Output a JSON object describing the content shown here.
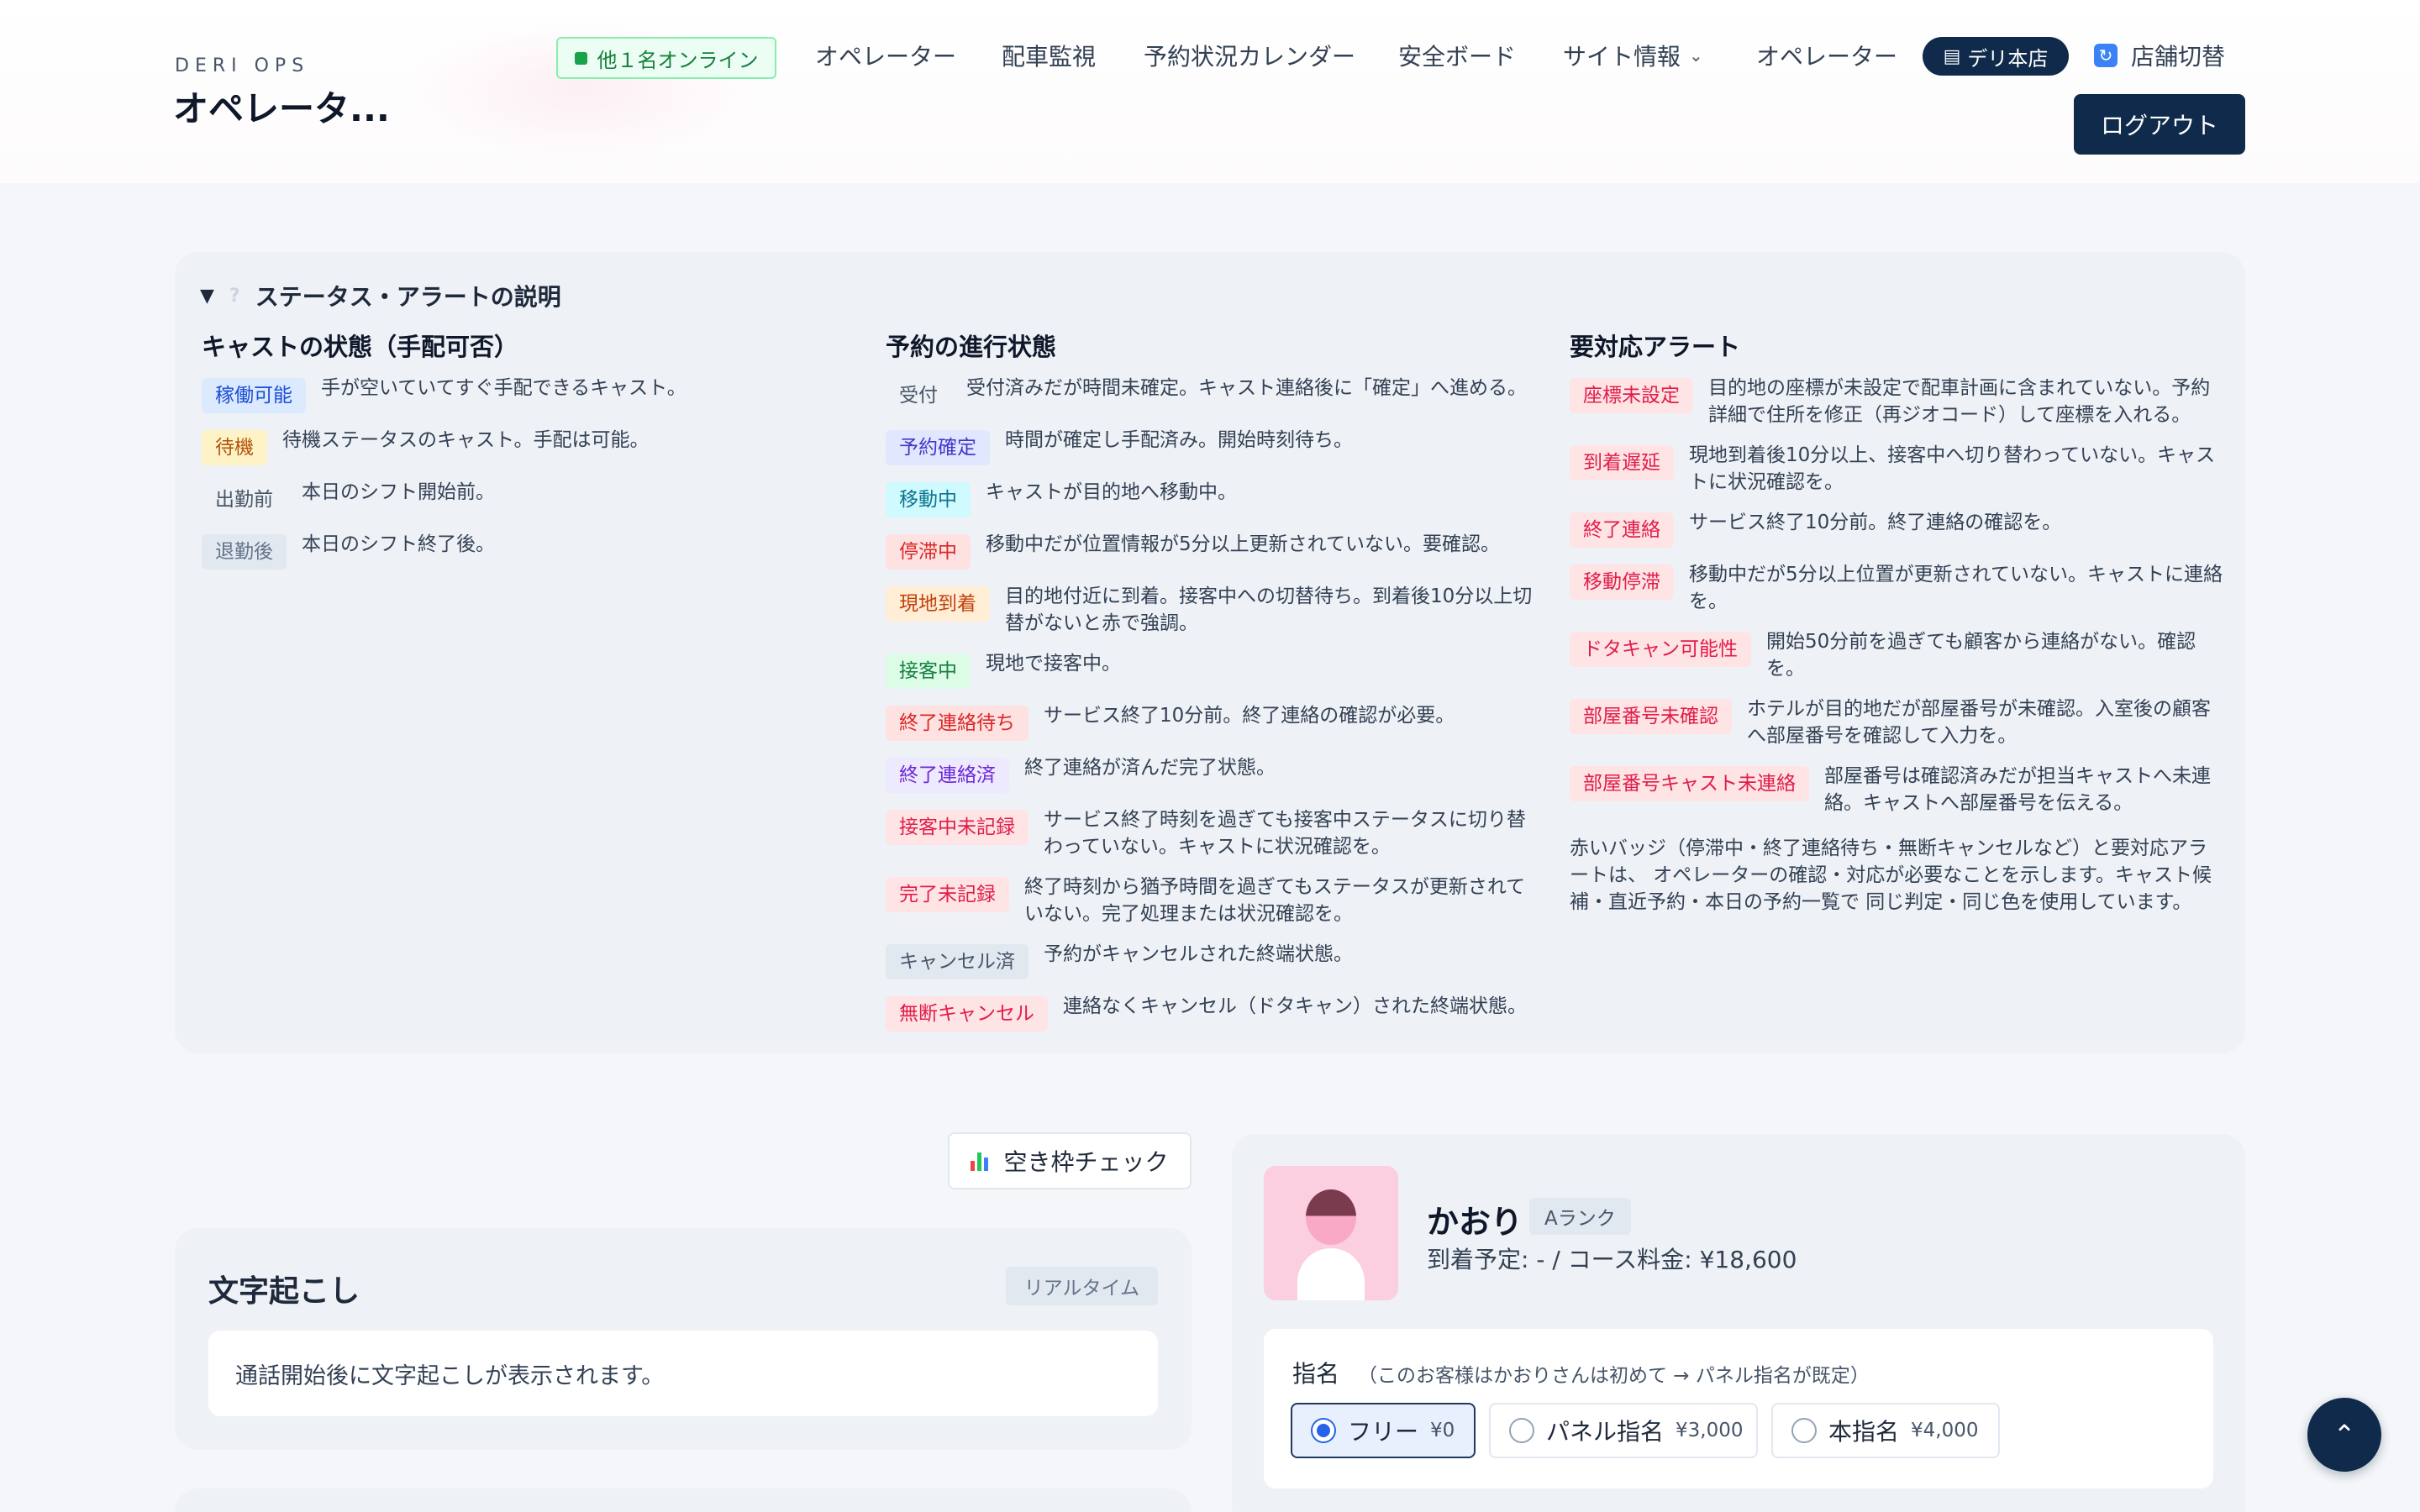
{
  "header": {
    "brand_sub": "DERI OPS",
    "brand_title": "オペレータ...",
    "online_badge": "他１名オンライン",
    "nav": [
      {
        "label": "オペレーター"
      },
      {
        "label": "配車監視"
      },
      {
        "label": "予約状況カレンダー"
      },
      {
        "label": "安全ボード"
      },
      {
        "label": "サイト情報"
      },
      {
        "label": "オペレーター"
      }
    ],
    "store_pill": "デリ本店",
    "switch_store": "店舗切替",
    "logout": "ログアウト"
  },
  "legend": {
    "toggle_label": "ステータス・アラートの説明",
    "cast": {
      "heading": "キャストの状態（手配可否）",
      "items": [
        {
          "badge": "稼働可能",
          "desc": "手が空いていてすぐ手配できるキャスト。"
        },
        {
          "badge": "待機",
          "desc": "待機ステータスのキャスト。手配は可能。"
        },
        {
          "badge": "出勤前",
          "desc": "本日のシフト開始前。"
        },
        {
          "badge": "退勤後",
          "desc": "本日のシフト終了後。"
        }
      ]
    },
    "booking": {
      "heading": "予約の進行状態",
      "items": [
        {
          "badge": "受付",
          "desc": "受付済みだが時間未確定。キャスト連絡後に「確定」へ進める。"
        },
        {
          "badge": "予約確定",
          "desc": "時間が確定し手配済み。開始時刻待ち。"
        },
        {
          "badge": "移動中",
          "desc": "キャストが目的地へ移動中。"
        },
        {
          "badge": "停滞中",
          "desc": "移動中だが位置情報が5分以上更新されていない。要確認。"
        },
        {
          "badge": "現地到着",
          "desc": "目的地付近に到着。接客中への切替待ち。到着後10分以上切替がないと赤で強調。"
        },
        {
          "badge": "接客中",
          "desc": "現地で接客中。"
        },
        {
          "badge": "終了連絡待ち",
          "desc": "サービス終了10分前。終了連絡の確認が必要。"
        },
        {
          "badge": "終了連絡済",
          "desc": "終了連絡が済んだ完了状態。"
        },
        {
          "badge": "接客中未記録",
          "desc": "サービス終了時刻を過ぎても接客中ステータスに切り替わっていない。キャストに状況確認を。"
        },
        {
          "badge": "完了未記録",
          "desc": "終了時刻から猶予時間を過ぎてもステータスが更新されていない。完了処理または状況確認を。"
        },
        {
          "badge": "キャンセル済",
          "desc": "予約がキャンセルされた終端状態。"
        },
        {
          "badge": "無断キャンセル",
          "desc": "連絡なくキャンセル（ドタキャン）された終端状態。"
        }
      ]
    },
    "alerts": {
      "heading": "要対応アラート",
      "items": [
        {
          "badge": "座標未設定",
          "desc": "目的地の座標が未設定で配車計画に含まれていない。予約詳細で住所を修正（再ジオコード）して座標を入れる。"
        },
        {
          "badge": "到着遅延",
          "desc": "現地到着後10分以上、接客中へ切り替わっていない。キャストに状況確認を。"
        },
        {
          "badge": "終了連絡",
          "desc": "サービス終了10分前。終了連絡の確認を。"
        },
        {
          "badge": "移動停滞",
          "desc": "移動中だが5分以上位置が更新されていない。キャストに連絡を。"
        },
        {
          "badge": "ドタキャン可能性",
          "desc": "開始50分前を過ぎても顧客から連絡がない。確認を。"
        },
        {
          "badge": "部屋番号未確認",
          "desc": "ホテルが目的地だが部屋番号が未確認。入室後の顧客へ部屋番号を確認して入力を。"
        },
        {
          "badge": "部屋番号キャスト未連絡",
          "desc": "部屋番号は確認済みだが担当キャストへ未連絡。キャストへ部屋番号を伝える。"
        }
      ],
      "note": "赤いバッジ（停滞中・終了連絡待ち・無断キャンセルなど）と要対応アラートは、 オペレーターの確認・対応が必要なことを示します。キャスト候補・直近予約・本日の予約一覧で 同じ判定・同じ色を使用しています。"
    }
  },
  "vacancy_button": "空き枠チェック",
  "transcript": {
    "title": "文字起こし",
    "badge": "リアルタイム",
    "placeholder": "通話開始後に文字起こしが表示されます。"
  },
  "cast_card": {
    "name": "かおり",
    "rank": "Aランク",
    "arrival": "到着予定: - / コース料金: ¥18,600",
    "nomination": {
      "label": "指名",
      "hint": "（このお客様はかおりさんは初めて → パネル指名が既定）",
      "options": [
        {
          "label": "フリー",
          "price": "¥0",
          "selected": true
        },
        {
          "label": "パネル指名",
          "price": "¥3,000",
          "selected": false
        },
        {
          "label": "本指名",
          "price": "¥4,000",
          "selected": false
        }
      ]
    }
  },
  "icons": {
    "store": "store-icon",
    "switch": "refresh-icon",
    "chart": "bar-chart-icon",
    "scroll_top": "chevron-up-icon"
  }
}
